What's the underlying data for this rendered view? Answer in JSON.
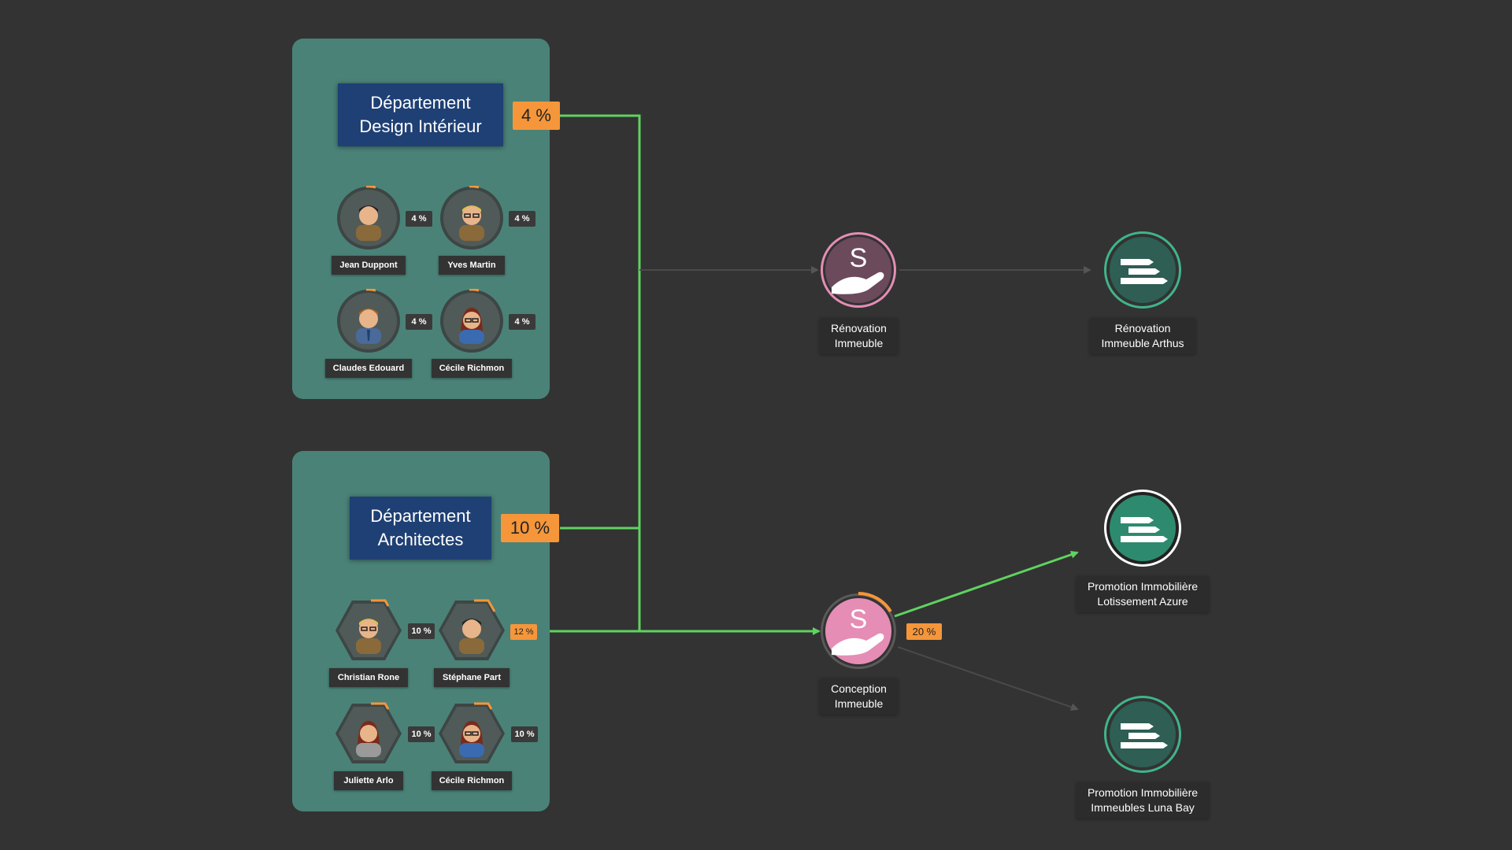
{
  "departments": [
    {
      "title_line1": "Département",
      "title_line2": "Design Intérieur",
      "percent": "4 %",
      "members": [
        {
          "name": "Jean Duppont",
          "percent": "4 %"
        },
        {
          "name": "Yves Martin",
          "percent": "4 %"
        },
        {
          "name": "Claudes Edouard",
          "percent": "4 %"
        },
        {
          "name": "Cécile Richmon",
          "percent": "4 %"
        }
      ]
    },
    {
      "title_line1": "Département",
      "title_line2": "Architectes",
      "percent": "10 %",
      "members": [
        {
          "name": "Christian Rone",
          "percent": "10 %"
        },
        {
          "name": "Stéphane Part",
          "percent": "12 %"
        },
        {
          "name": "Juliette Arlo",
          "percent": "10 %"
        },
        {
          "name": "Cécile Richmon",
          "percent": "10 %"
        }
      ]
    }
  ],
  "services": [
    {
      "line1": "Rénovation",
      "line2": "Immeuble",
      "icon": "service-hand-icon",
      "ring_color": "#e58db5",
      "fill_color": "#6b4a5c"
    },
    {
      "line1": "Conception",
      "line2": "Immeuble",
      "icon": "service-hand-icon",
      "percent": "20 %",
      "fill_color": "#e58db5"
    }
  ],
  "projects": [
    {
      "line1": "Rénovation",
      "line2": "Immeuble Arthus",
      "icon": "project-list-icon"
    },
    {
      "line1": "Promotion Immobilière",
      "line2": "Lotissement Azure",
      "icon": "project-list-icon",
      "highlighted": true
    },
    {
      "line1": "Promotion Immobilière",
      "line2": "Immeubles Luna Bay",
      "icon": "project-list-icon"
    }
  ],
  "colors": {
    "background": "#333333",
    "group_box": "#4a8278",
    "dept_title": "#1f4074",
    "percent_badge": "#f5963a",
    "active_link": "#5fd35f",
    "inactive_link": "#4a4a4a",
    "project_green": "#2e6e5c",
    "project_ring": "#3fb58a"
  }
}
